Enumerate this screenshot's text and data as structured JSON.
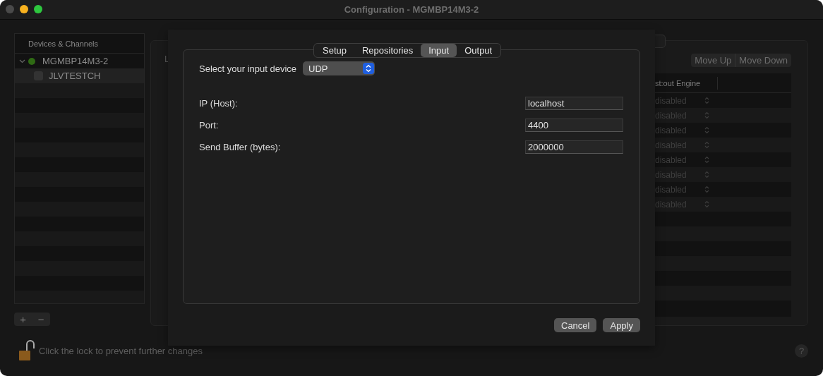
{
  "window": {
    "title": "Configuration - MGMBP14M3-2"
  },
  "sidebar": {
    "header": "Devices & Channels",
    "items": [
      {
        "label": "MGMBP14M3-2",
        "expanded": true,
        "color": "#2f6a14",
        "children": [
          {
            "label": "JLVTESTCH",
            "selected": true,
            "checked": false
          }
        ]
      }
    ]
  },
  "sidebar_buttons": [
    "+",
    "−"
  ],
  "lock": {
    "text": "Click the lock to prevent further changes",
    "locked": false
  },
  "panel": {
    "label": "L",
    "buttons": [
      "Move Up",
      "Move Down"
    ],
    "column": "st:out Engine",
    "rows": [
      {
        "value": "disabled"
      },
      {
        "value": "disabled"
      },
      {
        "value": "disabled"
      },
      {
        "value": "disabled"
      },
      {
        "value": "disabled"
      },
      {
        "value": "disabled"
      },
      {
        "value": "disabled"
      },
      {
        "value": "disabled"
      }
    ]
  },
  "help": "?",
  "sheet": {
    "tabs": [
      {
        "label": "Setup",
        "selected": false
      },
      {
        "label": "Repositories",
        "selected": false
      },
      {
        "label": "Input",
        "selected": true
      },
      {
        "label": "Output",
        "selected": false
      }
    ],
    "device_label": "Select your input device",
    "device_value": "UDP",
    "fields": [
      {
        "label": "IP (Host):",
        "value": "localhost"
      },
      {
        "label": "Port:",
        "value": "4400"
      },
      {
        "label": "Send Buffer (bytes):",
        "value": "2000000"
      }
    ],
    "buttons": [
      "Cancel",
      "Apply"
    ]
  }
}
